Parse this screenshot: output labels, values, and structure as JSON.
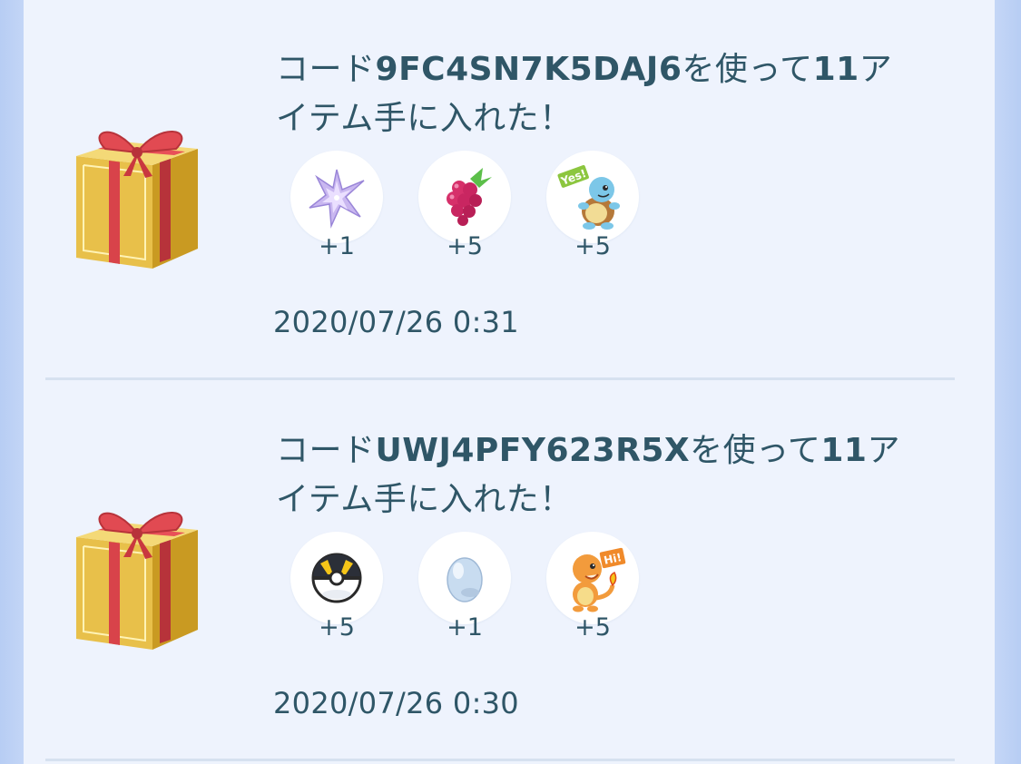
{
  "entries": [
    {
      "message_prefix": "コード",
      "code": "9FC4SN7K5DAJ6",
      "message_mid": "を使って",
      "count": "11",
      "message_suffix": "アイテム手に入れた！",
      "rewards": [
        {
          "icon": "stardust-icon",
          "quantity": "+1"
        },
        {
          "icon": "razz-berry-icon",
          "quantity": "+5"
        },
        {
          "icon": "squirtle-sticker-icon",
          "quantity": "+5"
        }
      ],
      "timestamp": "2020/07/26 0:31"
    },
    {
      "message_prefix": "コード",
      "code": "UWJ4PFY623R5X",
      "message_mid": "を使って",
      "count": "11",
      "message_suffix": "アイテム手に入れた！",
      "rewards": [
        {
          "icon": "ultra-ball-icon",
          "quantity": "+5"
        },
        {
          "icon": "egg-icon",
          "quantity": "+1"
        },
        {
          "icon": "charmander-sticker-icon",
          "quantity": "+5"
        }
      ],
      "timestamp": "2020/07/26 0:30"
    }
  ],
  "sticker_text": {
    "squirtle": "Yes!",
    "charmander": "Hi!"
  },
  "colors": {
    "text": "#2f5667",
    "panel": "#eef3fd",
    "divider": "#d6e1f0",
    "gift_gold": "#e9c24a",
    "ribbon_red": "#d8434a"
  }
}
